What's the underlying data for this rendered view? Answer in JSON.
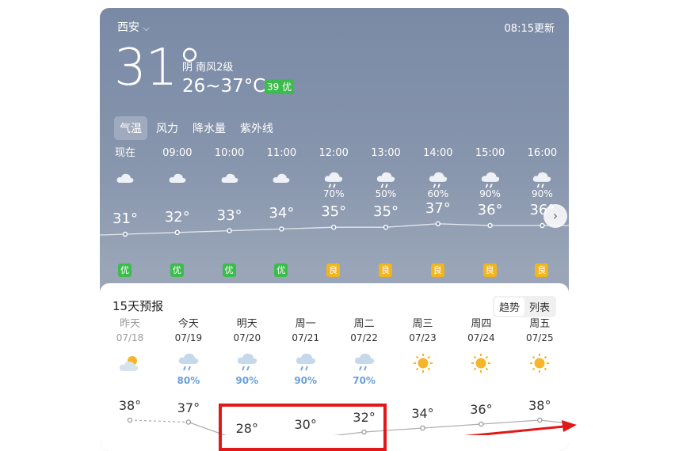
{
  "header": {
    "city": "西安",
    "update": "08:15更新",
    "temp": "31°",
    "desc": "阴 南风2级",
    "range": "26~37°C",
    "aqi": "39 优"
  },
  "tabs": [
    "气温",
    "风力",
    "降水量",
    "紫外线"
  ],
  "hourly": [
    {
      "time": "现在",
      "icon": "cloudy-icon",
      "precip": "",
      "temp": "31°",
      "t": 31,
      "aq": "优"
    },
    {
      "time": "09:00",
      "icon": "cloudy-icon",
      "precip": "",
      "temp": "32°",
      "t": 32,
      "aq": "优"
    },
    {
      "time": "10:00",
      "icon": "cloudy-icon",
      "precip": "",
      "temp": "33°",
      "t": 33,
      "aq": "优"
    },
    {
      "time": "11:00",
      "icon": "cloudy-icon",
      "precip": "",
      "temp": "34°",
      "t": 34,
      "aq": "优"
    },
    {
      "time": "12:00",
      "icon": "rain-icon",
      "precip": "70%",
      "temp": "35°",
      "t": 35,
      "aq": "良"
    },
    {
      "time": "13:00",
      "icon": "rain-icon",
      "precip": "50%",
      "temp": "35°",
      "t": 35,
      "aq": "良"
    },
    {
      "time": "14:00",
      "icon": "rain-icon",
      "precip": "60%",
      "temp": "37°",
      "t": 37,
      "aq": "良"
    },
    {
      "time": "15:00",
      "icon": "rain-icon",
      "precip": "90%",
      "temp": "36°",
      "t": 36,
      "aq": "良"
    },
    {
      "time": "16:00",
      "icon": "rain-icon",
      "precip": "90%",
      "temp": "36°",
      "t": 36,
      "aq": "良"
    }
  ],
  "forecast": {
    "title": "15天预报",
    "toggle": [
      "趋势",
      "列表"
    ],
    "days": [
      {
        "day": "昨天",
        "date": "07/18",
        "icon": "sunny-cloud-icon",
        "precip": "",
        "high": "38°",
        "h": 38,
        "past": true
      },
      {
        "day": "今天",
        "date": "07/19",
        "icon": "rain-cloud-icon",
        "precip": "80%",
        "high": "37°",
        "h": 37,
        "past": false
      },
      {
        "day": "明天",
        "date": "07/20",
        "icon": "rain-cloud-icon",
        "precip": "90%",
        "high": "28°",
        "h": 28,
        "past": false
      },
      {
        "day": "周一",
        "date": "07/21",
        "icon": "rain-cloud-icon",
        "precip": "90%",
        "high": "30°",
        "h": 30,
        "past": false
      },
      {
        "day": "周二",
        "date": "07/22",
        "icon": "rain-cloud-icon",
        "precip": "70%",
        "high": "32°",
        "h": 32,
        "past": false
      },
      {
        "day": "周三",
        "date": "07/23",
        "icon": "sun-icon",
        "precip": "",
        "high": "34°",
        "h": 34,
        "past": false
      },
      {
        "day": "周四",
        "date": "07/24",
        "icon": "sun-icon",
        "precip": "",
        "high": "36°",
        "h": 36,
        "past": false
      },
      {
        "day": "周五",
        "date": "07/25",
        "icon": "sun-icon",
        "precip": "",
        "high": "38°",
        "h": 38,
        "past": false
      }
    ]
  },
  "colors": {
    "good": "#3cbc4d",
    "moderate": "#f2b51c",
    "highlight": "#e01818",
    "rain": "#6aa0d8",
    "sun": "#f7b52b"
  }
}
